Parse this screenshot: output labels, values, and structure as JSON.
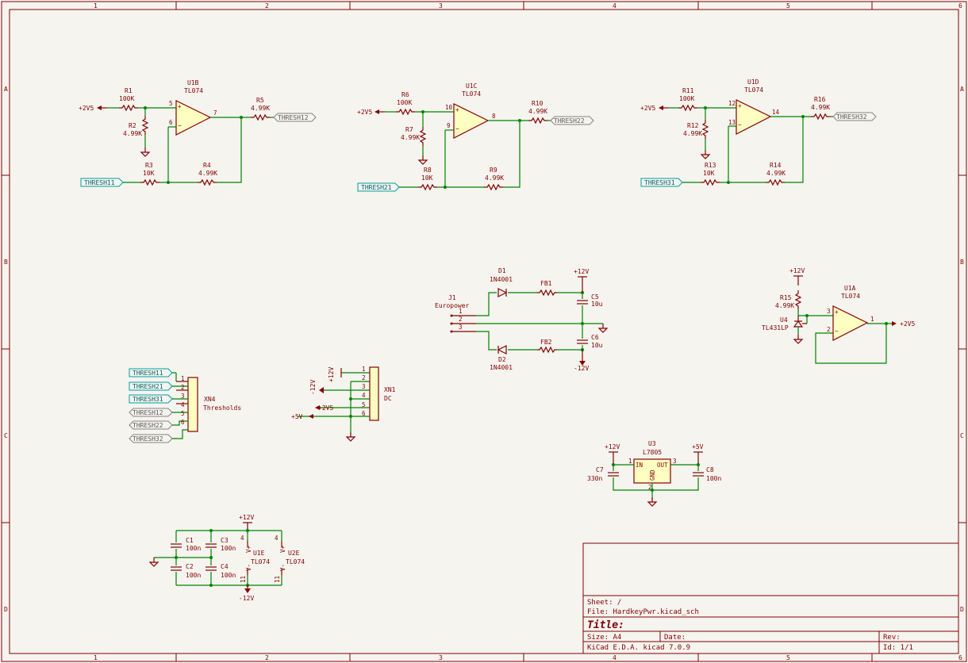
{
  "border": {
    "columns": [
      "1",
      "2",
      "3",
      "4",
      "5",
      "6"
    ],
    "rows": [
      "A",
      "B",
      "C",
      "D"
    ]
  },
  "title_block": {
    "sheet": "Sheet: /",
    "file": "File: HardkeyPwr.kicad_sch",
    "title": "Title:",
    "size": "Size: A4",
    "date": "Date:",
    "rev": "Rev:",
    "tool": "KiCad E.D.A.  kicad 7.0.9",
    "id": "Id: 1/1"
  },
  "opamps": [
    {
      "ref": "U1B",
      "value": "TL074",
      "pin_plus": "5",
      "pin_minus": "6",
      "pin_out": "7"
    },
    {
      "ref": "U1C",
      "value": "TL074",
      "pin_plus": "10",
      "pin_minus": "9",
      "pin_out": "8"
    },
    {
      "ref": "U1D",
      "value": "TL074",
      "pin_plus": "12",
      "pin_minus": "13",
      "pin_out": "14"
    },
    {
      "ref": "U1A",
      "value": "TL074",
      "pin_plus": "3",
      "pin_minus": "2",
      "pin_out": "1"
    }
  ],
  "resistors": [
    {
      "ref": "R1",
      "value": "100K"
    },
    {
      "ref": "R2",
      "value": "4.99K"
    },
    {
      "ref": "R3",
      "value": "10K"
    },
    {
      "ref": "R4",
      "value": "4.99K"
    },
    {
      "ref": "R5",
      "value": "4.99K"
    },
    {
      "ref": "R6",
      "value": "100K"
    },
    {
      "ref": "R7",
      "value": "4.99K"
    },
    {
      "ref": "R8",
      "value": "10K"
    },
    {
      "ref": "R9",
      "value": "4.99K"
    },
    {
      "ref": "R10",
      "value": "4.99K"
    },
    {
      "ref": "R11",
      "value": "100K"
    },
    {
      "ref": "R12",
      "value": "4.99K"
    },
    {
      "ref": "R13",
      "value": "10K"
    },
    {
      "ref": "R14",
      "value": "4.99K"
    },
    {
      "ref": "R15",
      "value": "4.99K"
    },
    {
      "ref": "R16",
      "value": "4.99K"
    }
  ],
  "power": {
    "p2v5": "+2V5",
    "p12": "+12V",
    "n12": "-12V",
    "p5": "+5V"
  },
  "labels": {
    "thresh11": "THRESH11",
    "thresh12": "THRESH12",
    "thresh21": "THRESH21",
    "thresh22": "THRESH22",
    "thresh31": "THRESH31",
    "thresh32": "THRESH32"
  },
  "supply": {
    "j1_ref": "J1",
    "j1_value": "Europower",
    "j1_pins": [
      "1",
      "2",
      "3"
    ],
    "d1_ref": "D1",
    "d1_value": "1N4001",
    "d2_ref": "D2",
    "d2_value": "1N4001",
    "fb1": "FB1",
    "fb2": "FB2",
    "c5_ref": "C5",
    "c5_value": "10u",
    "c6_ref": "C6",
    "c6_value": "10u"
  },
  "reference": {
    "r15": "R15",
    "u4_ref": "U4",
    "u4_value": "TL431LP"
  },
  "xn4": {
    "ref": "XN4",
    "value": "Thresholds",
    "pins": [
      "1",
      "2",
      "3",
      "4",
      "5",
      "6"
    ]
  },
  "xn1": {
    "ref": "XN1",
    "value": "DC",
    "pins": [
      "1",
      "2",
      "3",
      "4",
      "5",
      "6"
    ]
  },
  "regulator": {
    "ref": "U3",
    "value": "L7805",
    "in_label": "IN",
    "out_label": "OUT",
    "gnd_label": "GND",
    "pin_in": "1",
    "pin_out": "3",
    "pin_gnd": "2",
    "c7_ref": "C7",
    "c7_value": "330n",
    "c8_ref": "C8",
    "c8_value": "100n"
  },
  "decoupling": {
    "c1_ref": "C1",
    "c1_value": "100n",
    "c2_ref": "C2",
    "c2_value": "100n",
    "c3_ref": "C3",
    "c3_value": "100n",
    "c4_ref": "C4",
    "c4_value": "100n",
    "u1e_ref": "U1E",
    "u1e_value": "TL074",
    "u2e_ref": "U2E",
    "u2e_value": "TL074",
    "vplus": "V+",
    "vminus": "V-",
    "pin4": "4",
    "pin11": "11"
  }
}
